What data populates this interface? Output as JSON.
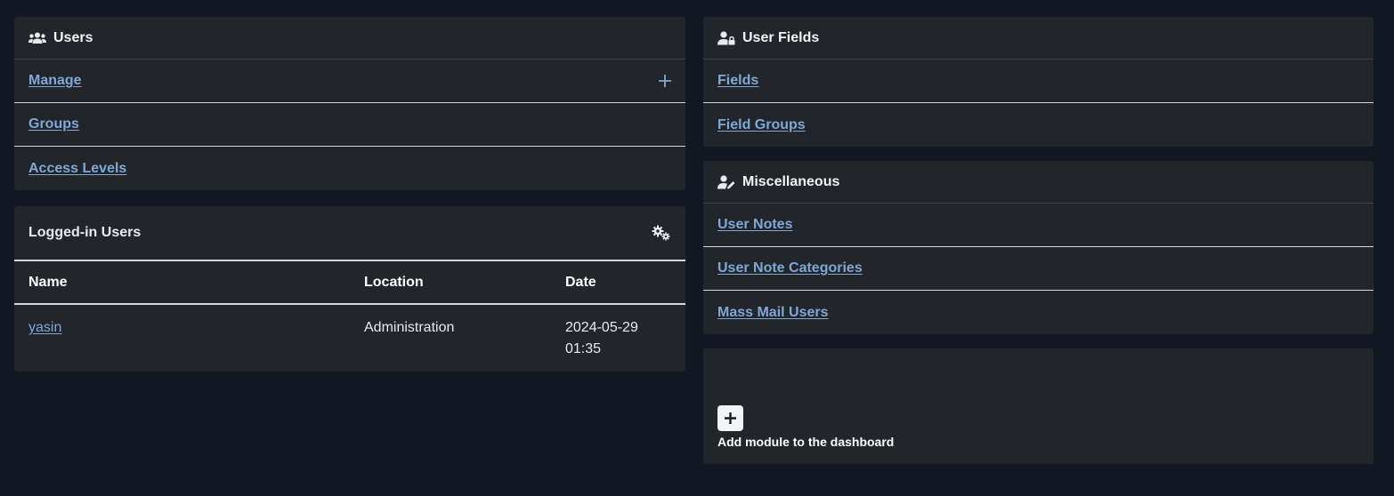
{
  "users_panel": {
    "title": "Users",
    "items": [
      {
        "label": "Manage"
      },
      {
        "label": "Groups"
      },
      {
        "label": "Access Levels"
      }
    ]
  },
  "logged_in": {
    "title": "Logged-in Users",
    "columns": [
      "Name",
      "Location",
      "Date"
    ],
    "rows": [
      {
        "name": "yasin",
        "location": "Administration",
        "date_line1": "2024-05-29",
        "date_line2": "01:35"
      }
    ]
  },
  "user_fields_panel": {
    "title": "User Fields",
    "items": [
      {
        "label": "Fields"
      },
      {
        "label": "Field Groups"
      }
    ]
  },
  "misc_panel": {
    "title": "Miscellaneous",
    "items": [
      {
        "label": "User Notes"
      },
      {
        "label": "User Note Categories"
      },
      {
        "label": "Mass Mail Users"
      }
    ]
  },
  "add_module": {
    "label": "Add module to the dashboard"
  },
  "colors": {
    "background": "#111822",
    "card": "#22252a",
    "link": "#7fa8d8",
    "divider": "#d5d9de"
  },
  "icons": {
    "users": "users-icon",
    "user_fields": "user-lock-icon",
    "misc": "user-edit-icon",
    "settings": "cogs-icon",
    "add": "plus-icon"
  }
}
